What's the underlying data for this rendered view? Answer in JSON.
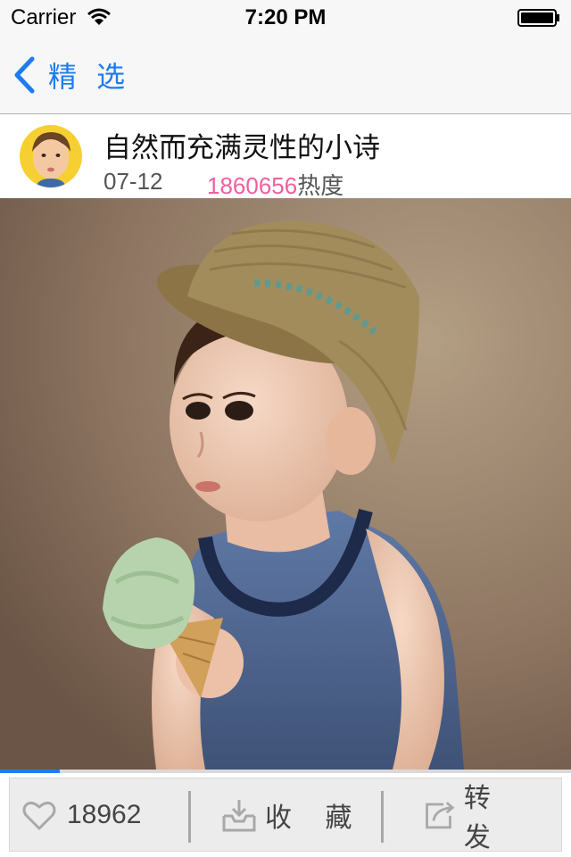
{
  "status_bar": {
    "carrier": "Carrier",
    "time": "7:20 PM"
  },
  "nav": {
    "back_label": "精 选"
  },
  "post": {
    "title": "自然而充满灵性的小诗",
    "date": "07-12",
    "heat_value": "1860656",
    "heat_label": "热度"
  },
  "media": {
    "progress_fraction": 0.105
  },
  "actions": {
    "like_count": "18962",
    "collect_label": "收 藏",
    "share_label": "转 发"
  },
  "colors": {
    "accent": "#1e7cf2",
    "heat": "#f0609e",
    "bar_bg": "#f7f7f7",
    "action_bg": "#ececec"
  },
  "icons": {
    "wifi": "wifi-icon",
    "battery": "battery-icon",
    "back": "chevron-left-icon",
    "like": "heart-icon",
    "collect": "inbox-download-icon",
    "share": "share-arrow-icon"
  }
}
